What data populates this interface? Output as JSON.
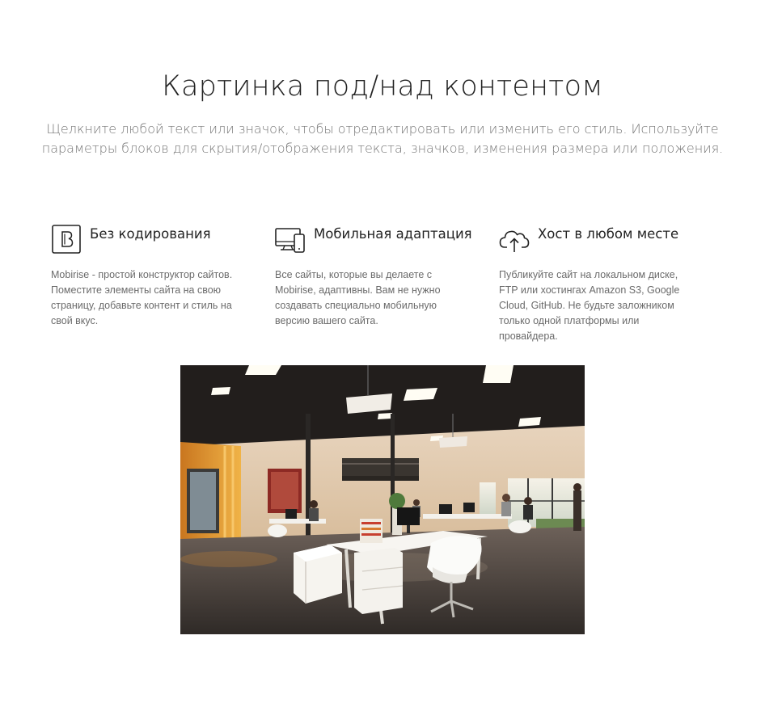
{
  "header": {
    "title": "Картинка под/над контентом",
    "subtitle": "Щелкните любой текст или значок, чтобы отредактировать или изменить его стиль. Используйте параметры блоков для скрытия/отображения текста, значков, изменения размера или положения."
  },
  "features": [
    {
      "icon": "bootstrap-b-icon",
      "title": "Без кодирования",
      "text": "Mobirise - простой конструктор сайтов. Поместите элементы сайта на свою страницу, добавьте контент и стиль на свой вкус."
    },
    {
      "icon": "desktop-mobile-icon",
      "title": "Мобильная адаптация",
      "text": "Все сайты, которые вы делаете с Mobirise, адаптивны. Вам не нужно создавать специально мобильную версию вашего сайта."
    },
    {
      "icon": "cloud-upload-icon",
      "title": "Хост в любом месте",
      "text": "Публикуйте сайт на локальном диске, FTP или хостингах Amazon S3, Google Cloud, GitHub. Не будьте заложником только одной платформы или провайдера."
    }
  ],
  "image": {
    "subject": "office-interior-photo"
  },
  "colors": {
    "heading": "#232323",
    "subtitle": "#767676",
    "body_text": "#6b6b6b"
  }
}
